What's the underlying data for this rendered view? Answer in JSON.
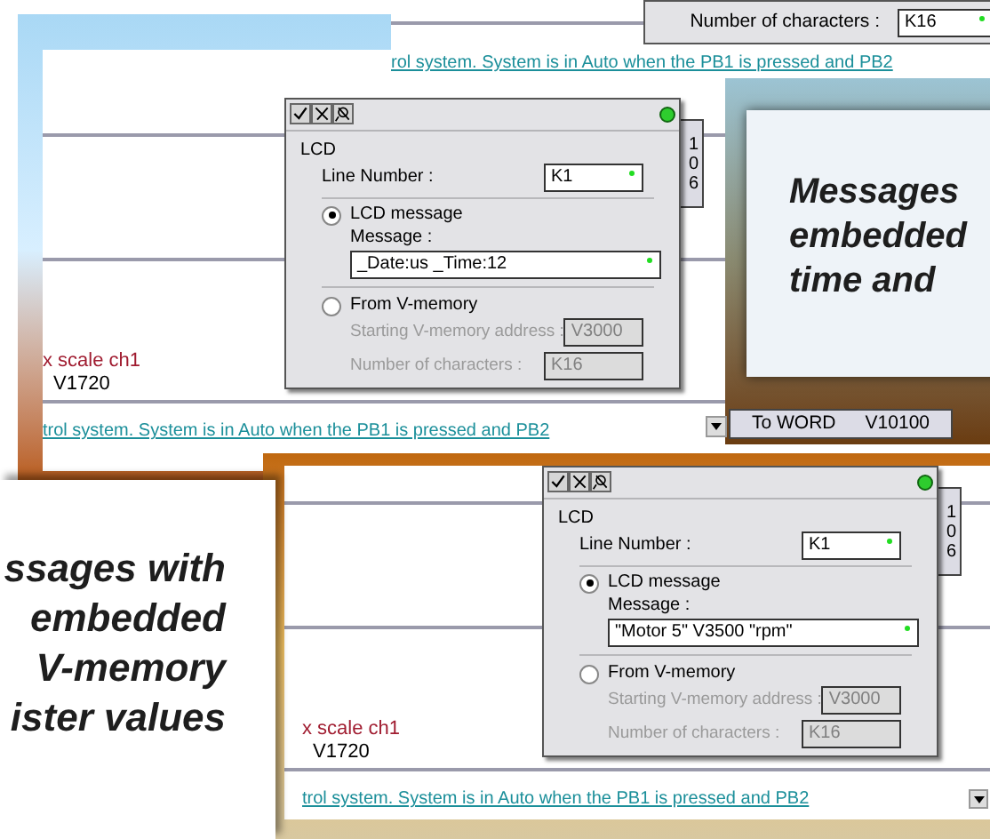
{
  "top_window": {
    "characters_label": "Number of characters :",
    "characters_value": "K16",
    "description": "rol system. System is in Auto when the PB1 is pressed and PB2"
  },
  "screens": [
    {
      "dialog": {
        "title": "LCD",
        "line_number_label": "Line Number :",
        "line_number": "K1",
        "options": [
          {
            "label": "LCD message",
            "selected": true
          },
          {
            "label": "From V-memory",
            "selected": false
          }
        ],
        "message_label": "Message :",
        "message": "_Date:us _Time:12",
        "address_label": "Starting V-memory address :",
        "address": "V3000",
        "characters_label": "Number of characters :",
        "characters": "K16"
      },
      "side_label": "x scale ch1",
      "side_value": "V1720",
      "side_digits": [
        "1",
        "0",
        "6"
      ],
      "description": "trol system. System is in Auto when the PB1 is pressed and PB2"
    },
    {
      "dialog": {
        "title": "LCD",
        "line_number_label": "Line Number :",
        "line_number": "K1",
        "options": [
          {
            "label": "LCD message",
            "selected": true
          },
          {
            "label": "From V-memory",
            "selected": false
          }
        ],
        "message_label": "Message :",
        "message": "\"Motor 5\" V3500 \"rpm\"",
        "address_label": "Starting V-memory address :",
        "address": "V3000",
        "characters_label": "Number of characters :",
        "characters": "K16"
      },
      "side_label": "x scale ch1",
      "side_value": "V1720",
      "side_digits": [
        "1",
        "0",
        "6"
      ],
      "description": "trol system. System is in Auto when the PB1 is pressed and PB2"
    }
  ],
  "to_word_button": {
    "label": "To WORD",
    "value": "V10100"
  },
  "captions": [
    {
      "lines": [
        "Messages",
        "embedded",
        "time and"
      ]
    },
    {
      "lines": [
        "ssages with",
        "embedded",
        "V-memory",
        "ister values"
      ]
    }
  ]
}
